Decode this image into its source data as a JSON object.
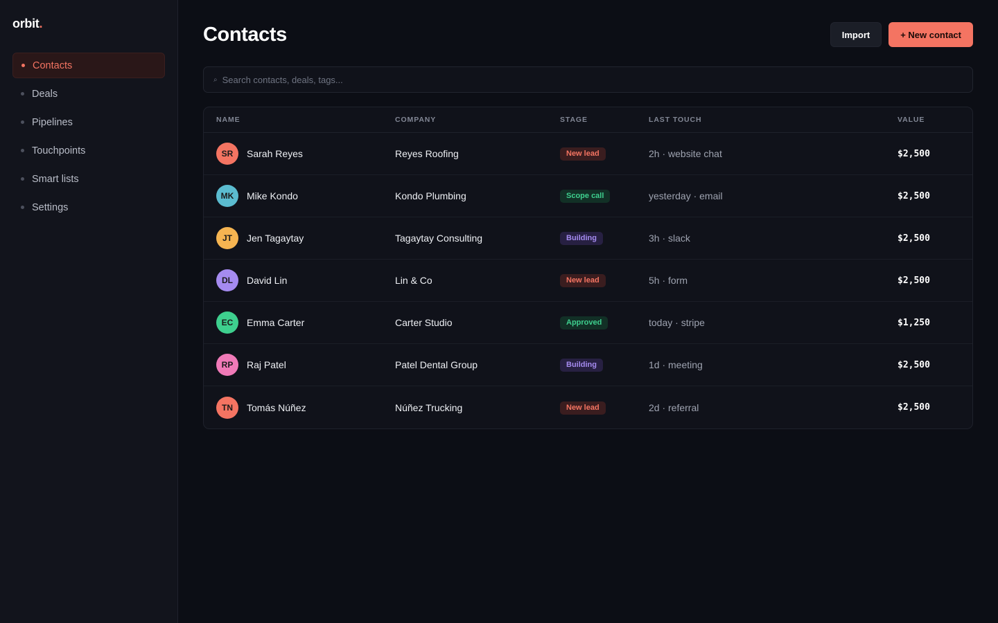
{
  "app": {
    "logo_text": "orbit",
    "logo_dot": "."
  },
  "sidebar": {
    "items": [
      {
        "label": "Contacts",
        "active": true
      },
      {
        "label": "Deals",
        "active": false
      },
      {
        "label": "Pipelines",
        "active": false
      },
      {
        "label": "Touchpoints",
        "active": false
      },
      {
        "label": "Smart lists",
        "active": false
      },
      {
        "label": "Settings",
        "active": false
      }
    ]
  },
  "header": {
    "title": "Contacts",
    "import_label": "Import",
    "new_contact_label": "+ New contact"
  },
  "search": {
    "icon": "search-icon",
    "glyph": "⌕",
    "placeholder": "Search contacts, deals, tags..."
  },
  "table": {
    "columns": [
      "NAME",
      "COMPANY",
      "STAGE",
      "LAST TOUCH",
      "VALUE"
    ],
    "rows": [
      {
        "initials": "SR",
        "name": "Sarah Reyes",
        "company": "Reyes Roofing",
        "stage": "New lead",
        "last_touch": "2h · website chat",
        "value": "$2,500",
        "avatar_color": "#f47462"
      },
      {
        "initials": "MK",
        "name": "Mike Kondo",
        "company": "Kondo Plumbing",
        "stage": "Scope call",
        "last_touch": "yesterday · email",
        "value": "$2,500",
        "avatar_color": "#5bbcd0"
      },
      {
        "initials": "JT",
        "name": "Jen Tagaytay",
        "company": "Tagaytay Consulting",
        "stage": "Building",
        "last_touch": "3h · slack",
        "value": "$2,500",
        "avatar_color": "#f5b451"
      },
      {
        "initials": "DL",
        "name": "David Lin",
        "company": "Lin & Co",
        "stage": "New lead",
        "last_touch": "5h · form",
        "value": "$2,500",
        "avatar_color": "#a58bf0"
      },
      {
        "initials": "EC",
        "name": "Emma Carter",
        "company": "Carter Studio",
        "stage": "Approved",
        "last_touch": "today · stripe",
        "value": "$1,250",
        "avatar_color": "#3ecf8e"
      },
      {
        "initials": "RP",
        "name": "Raj Patel",
        "company": "Patel Dental Group",
        "stage": "Building",
        "last_touch": "1d · meeting",
        "value": "$2,500",
        "avatar_color": "#f07ab8"
      },
      {
        "initials": "TN",
        "name": "Tomás Núñez",
        "company": "Núñez Trucking",
        "stage": "New lead",
        "last_touch": "2d · referral",
        "value": "$2,500",
        "avatar_color": "#f47462"
      }
    ]
  },
  "stage_colors": {
    "New lead": {
      "bg": "#3a1d1f",
      "fg": "#f47462"
    },
    "Scope call": {
      "bg": "#123026",
      "fg": "#3ecf8e"
    },
    "Building": {
      "bg": "#272042",
      "fg": "#a58bf0"
    },
    "Approved": {
      "bg": "#123026",
      "fg": "#3ecf8e"
    }
  },
  "colors": {
    "accent": "#f47462",
    "background": "#0c0e15",
    "sidebar": "#12141c"
  }
}
